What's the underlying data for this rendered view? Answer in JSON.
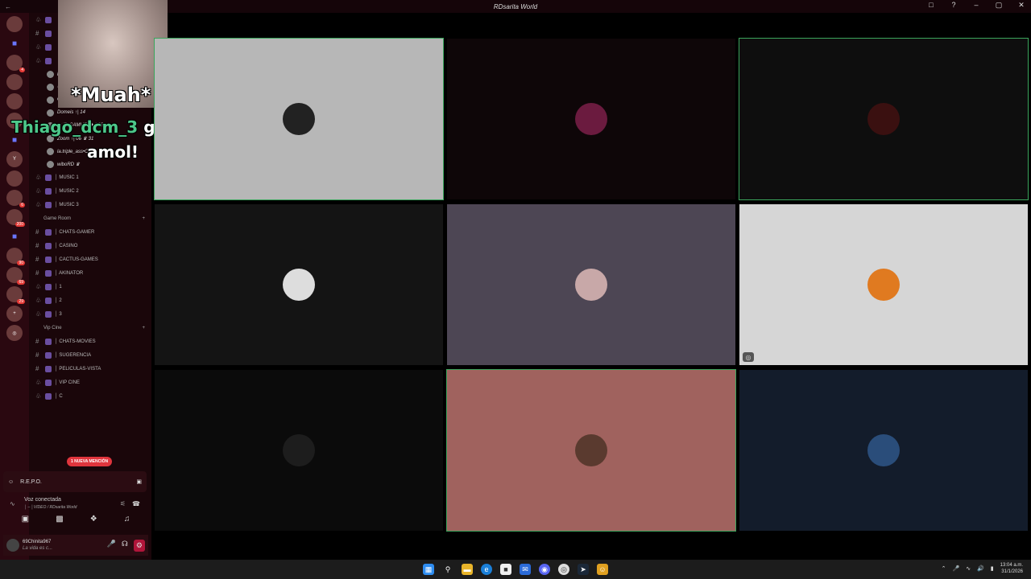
{
  "window": {
    "title": "RDsarita World",
    "back_glyph": "←"
  },
  "window_controls": [
    "□",
    "?",
    "–",
    "▢",
    "✕"
  ],
  "servers": [
    {
      "label": "",
      "badge": ""
    },
    {
      "label": "■",
      "folder": true
    },
    {
      "label": "",
      "badge": "4"
    },
    {
      "label": "",
      "badge": ""
    },
    {
      "label": "",
      "badge": ""
    },
    {
      "label": "",
      "badge": ""
    },
    {
      "label": "■",
      "folder": true
    },
    {
      "label": "Y",
      "badge": ""
    },
    {
      "label": "",
      "badge": ""
    },
    {
      "label": "",
      "badge": "6"
    },
    {
      "label": "",
      "badge": "200"
    },
    {
      "label": "■",
      "folder": true
    },
    {
      "label": "",
      "badge": "90"
    },
    {
      "label": "",
      "badge": "69"
    },
    {
      "label": "",
      "badge": "29"
    },
    {
      "label": "+",
      "badge": ""
    },
    {
      "label": "◎",
      "badge": ""
    }
  ],
  "channels_top": [
    {
      "sym": "♧",
      "name": ""
    },
    {
      "sym": "#",
      "name": ""
    },
    {
      "sym": "♧",
      "name": ""
    },
    {
      "sym": "♧",
      "name": ""
    }
  ],
  "voice_users": [
    {
      "name": "l lla.Montero ♛ 69"
    },
    {
      "name": "ේ Sara&W"
    },
    {
      "name": "CHAVEZZ"
    },
    {
      "name": "Domeis ↑| 14"
    },
    {
      "name": "ේ3_SAMUEL★ | 03"
    },
    {
      "name": "Zoom ↑| 06 ♛ 31"
    },
    {
      "name": "la.triple_ass•CQ.& ♛ 69"
    },
    {
      "name": "wiboRD ♛"
    }
  ],
  "music_channels": [
    {
      "sym": "♧",
      "name": "│ MUSIC 1"
    },
    {
      "sym": "♧",
      "name": "│ MUSIC 2"
    },
    {
      "sym": "♧",
      "name": "│ MUSIC 3"
    }
  ],
  "game_category": "Game Room",
  "game_channels": [
    {
      "sym": "#",
      "name": "│ CHATS-GAMER"
    },
    {
      "sym": "#",
      "name": "│ CASINO"
    },
    {
      "sym": "#",
      "name": "│ CACTUS-GAMES"
    },
    {
      "sym": "#",
      "name": "│ AKINATOR"
    },
    {
      "sym": "♧",
      "name": "│ 1"
    },
    {
      "sym": "♧",
      "name": "│ 2"
    },
    {
      "sym": "♧",
      "name": "│ 3"
    }
  ],
  "vip_category": "Vip Cine",
  "vip_channels": [
    {
      "sym": "#",
      "name": "│ CHATS-MOVIES"
    },
    {
      "sym": "#",
      "name": "│ SUGERENCIA"
    },
    {
      "sym": "#",
      "name": "│ PELICULAS-VISTA"
    },
    {
      "sym": "♧",
      "name": "│ VIP CINE"
    },
    {
      "sym": "♧",
      "name": "│ C"
    }
  ],
  "mention_badge": "1 NUEVA MENCIÓN",
  "activity": {
    "title": "R.E.P.O."
  },
  "voice_connection": {
    "status": "Voz conectada",
    "location": "│ – │VIDEO / RDsarita World"
  },
  "current_user": {
    "name": "69Chinita967",
    "status": "La vida es c..."
  },
  "overlay": {
    "muah": "*Muah*",
    "username": "Thiago_dcm_3",
    "word": "gracias",
    "tail": "amol!"
  },
  "tiles": [
    {
      "bg": "#b7b7b7",
      "speaking": true,
      "av": "#222"
    },
    {
      "bg": "#0e0608",
      "speaking": false,
      "av": "#6b1b3f"
    },
    {
      "bg": "#0e0e0e",
      "speaking": true,
      "av": "#3a1010"
    },
    {
      "bg": "#141414",
      "speaking": false,
      "av": "#ddd"
    },
    {
      "bg": "#4d4654",
      "speaking": false,
      "av": "#c8a8a8"
    },
    {
      "bg": "#d6d6d6",
      "speaking": false,
      "av": "#e07a20",
      "cam": true
    },
    {
      "bg": "#0b0b0b",
      "speaking": false,
      "av": "#1d1d1d"
    },
    {
      "bg": "#a0625e",
      "speaking": true,
      "av": "#5a3a2f"
    },
    {
      "bg": "#131c2b",
      "speaking": false,
      "av": "#2a4d7a"
    }
  ],
  "clock": {
    "time": "13:04 a.m.",
    "date": "31/1/2026"
  },
  "accent": "#3ba55c"
}
